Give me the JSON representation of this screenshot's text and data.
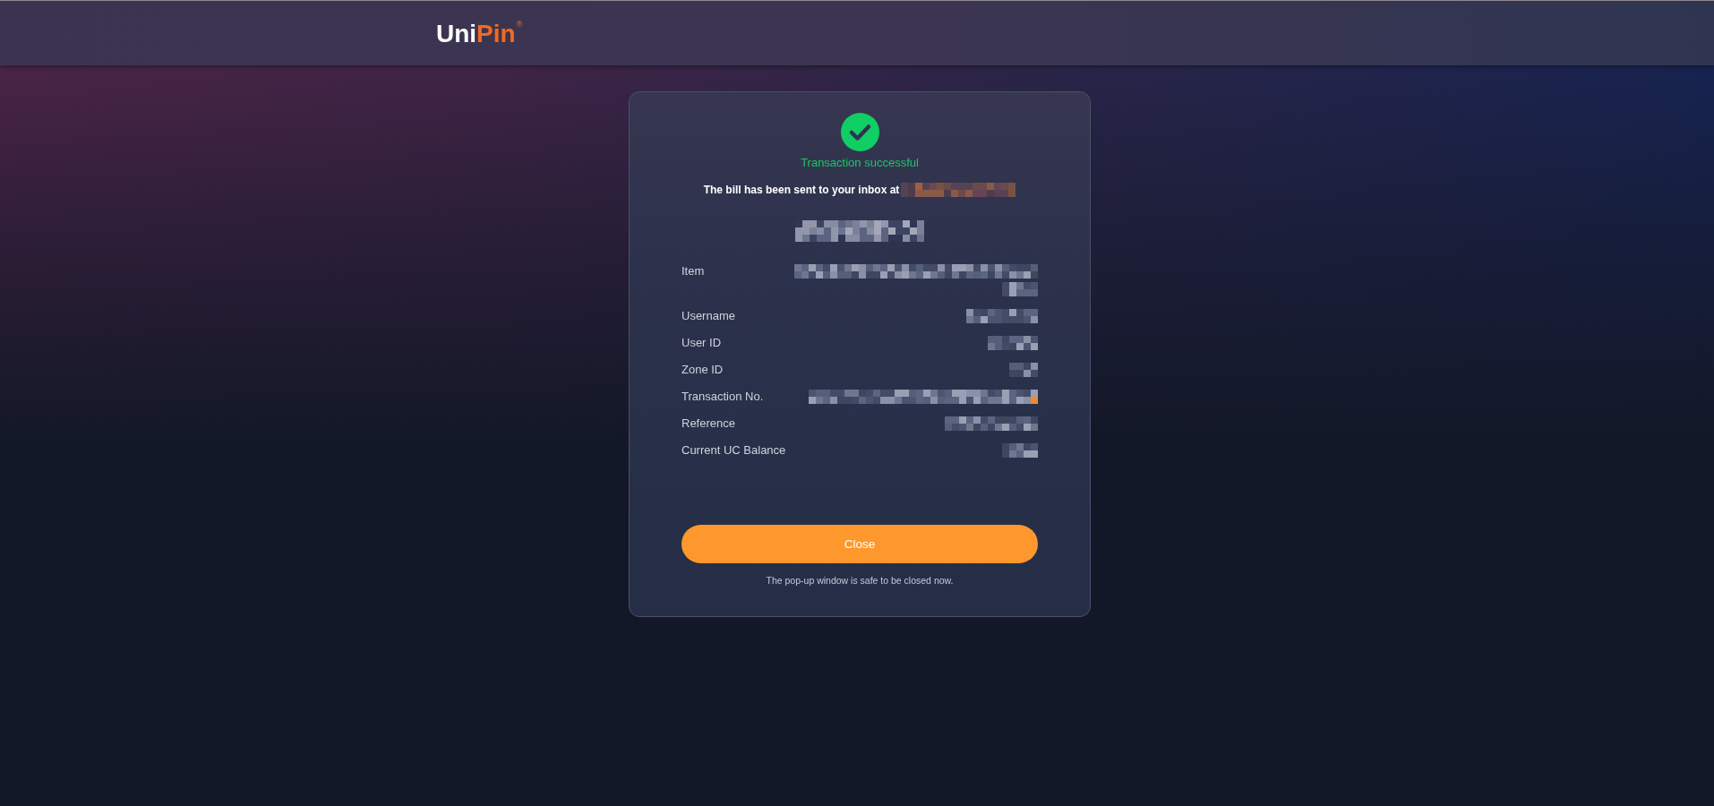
{
  "header": {
    "logo": {
      "primary": "Uni",
      "accent": "Pin",
      "mark": "®"
    }
  },
  "card": {
    "status": {
      "kind": "success",
      "text": "Transaction successful"
    },
    "bill_notice": {
      "text": "The bill has been sent to your inbox at",
      "email_pixelated": true
    },
    "amount": {
      "pixelated": true
    },
    "details": [
      {
        "label": "Item",
        "value_pixelated": true
      },
      {
        "label": "Username",
        "value_pixelated": true
      },
      {
        "label": "User ID",
        "value_pixelated": true
      },
      {
        "label": "Zone ID",
        "value_pixelated": true
      },
      {
        "label": "Transaction No.",
        "value_pixelated": true
      },
      {
        "label": "Reference",
        "value_pixelated": true
      },
      {
        "label": "Current UC Balance",
        "value_pixelated": true
      }
    ],
    "close_button": {
      "label": "Close"
    },
    "footnote": "The pop-up window is safe to be closed now."
  }
}
